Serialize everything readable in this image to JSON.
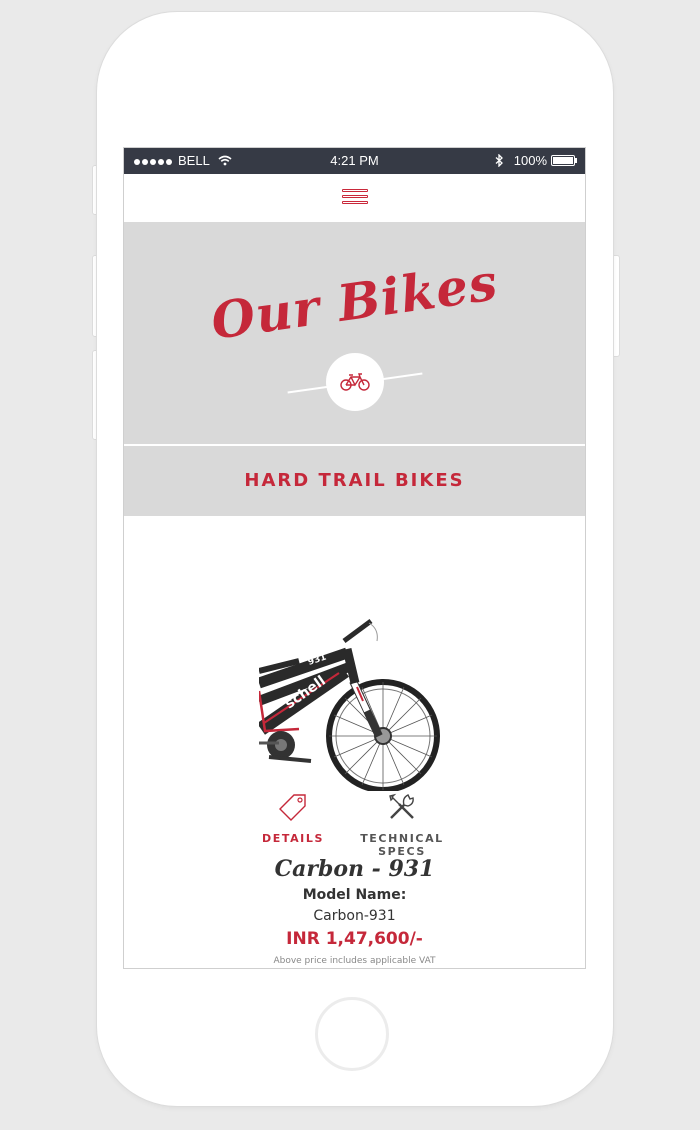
{
  "status_bar": {
    "carrier": "BELL",
    "time": "4:21 PM",
    "battery": "100%"
  },
  "hero": {
    "title": "Our Bikes"
  },
  "category": {
    "title": "HARD TRAIL BIKES"
  },
  "product": {
    "tabs": [
      {
        "label": "DETAILS",
        "icon": "price-tag-icon",
        "active": true
      },
      {
        "label": "TECHNICAL SPECS",
        "icon": "tools-icon",
        "active": false
      }
    ],
    "name": "Carbon - 931",
    "model_label": "Model Name:",
    "model_value": "Carbon-931",
    "price": "INR 1,47,600/-",
    "price_note": "Above price includes applicable VAT",
    "frame_text": "931"
  },
  "colors": {
    "accent": "#c5283a",
    "status_bar": "#363a45",
    "hero_bg": "#d9d9d9"
  }
}
